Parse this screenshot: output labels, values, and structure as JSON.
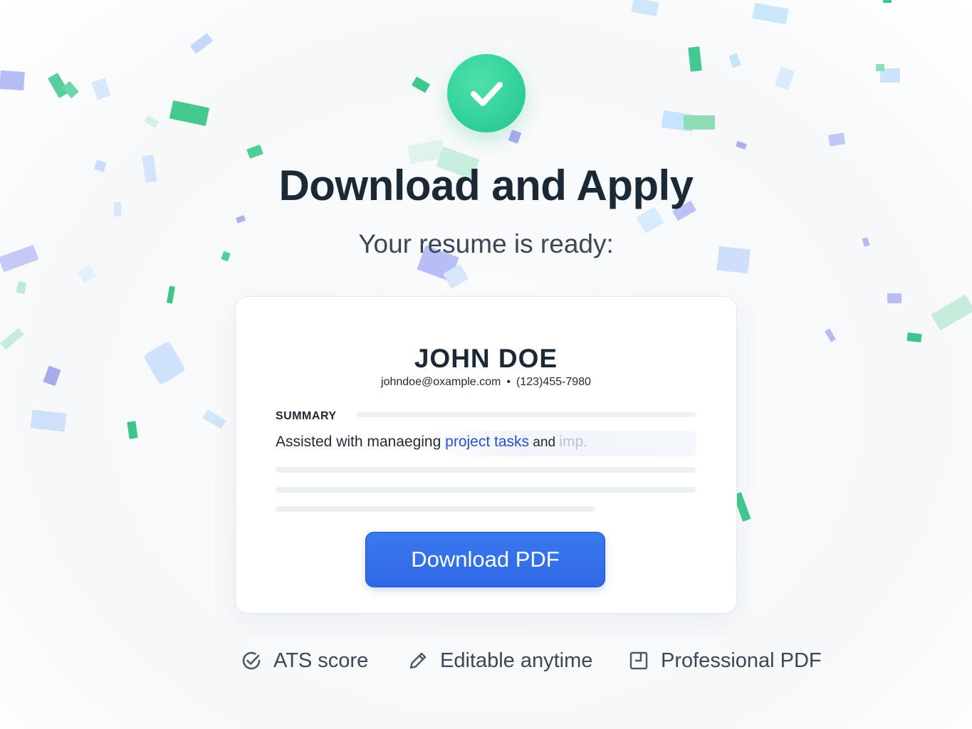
{
  "header": {
    "title": "Download and Apply",
    "subtitle": "Your resume is ready:"
  },
  "resume_preview": {
    "name": "JOHN DOE",
    "email": "johndoe@oxample.com",
    "separator": "•",
    "phone": "(123)455-7980",
    "section_label": "SUMMARY",
    "summary_plain": "Assisted with manaeging ",
    "summary_highlight": "project tasks",
    "summary_and": " and ",
    "summary_faded": "imp."
  },
  "actions": {
    "download_label": "Download PDF"
  },
  "features": [
    {
      "label": "ATS score",
      "icon": "check-circle-icon"
    },
    {
      "label": "Editable anytime",
      "icon": "pencil-icon"
    },
    {
      "label": "Professional PDF",
      "icon": "document-download-icon"
    }
  ],
  "colors": {
    "success_green": "#34d39b",
    "primary_blue": "#2f68e6",
    "highlight_blue": "#2450d8",
    "heading": "#1b2836",
    "body_text": "#3a4756"
  }
}
